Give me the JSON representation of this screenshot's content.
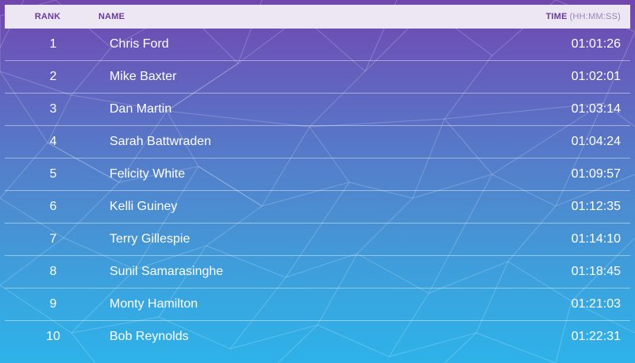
{
  "header": {
    "rank_label": "RANK",
    "name_label": "NAME",
    "time_label": "TIME",
    "time_unit": "(HH:MM:SS)"
  },
  "rows": [
    {
      "rank": "1",
      "name": "Chris Ford",
      "time": "01:01:26"
    },
    {
      "rank": "2",
      "name": "Mike Baxter",
      "time": "01:02:01"
    },
    {
      "rank": "3",
      "name": "Dan Martin",
      "time": "01:03:14"
    },
    {
      "rank": "4",
      "name": "Sarah Battwraden",
      "time": "01:04:24"
    },
    {
      "rank": "5",
      "name": "Felicity White",
      "time": "01:09:57"
    },
    {
      "rank": "6",
      "name": "Kelli Guiney",
      "time": "01:12:35"
    },
    {
      "rank": "7",
      "name": "Terry Gillespie",
      "time": "01:14:10"
    },
    {
      "rank": "8",
      "name": "Sunil Samarasinghe",
      "time": "01:18:45"
    },
    {
      "rank": "9",
      "name": "Monty Hamilton",
      "time": "01:21:03"
    },
    {
      "rank": "10",
      "name": "Bob Reynolds",
      "time": "01:22:31"
    }
  ],
  "colors": {
    "header_bg": "#ece7f3",
    "header_text": "#6a3c9c",
    "gradient_top": "#7046ad",
    "gradient_bottom": "#2eb2e9",
    "row_text": "#ffffff"
  }
}
